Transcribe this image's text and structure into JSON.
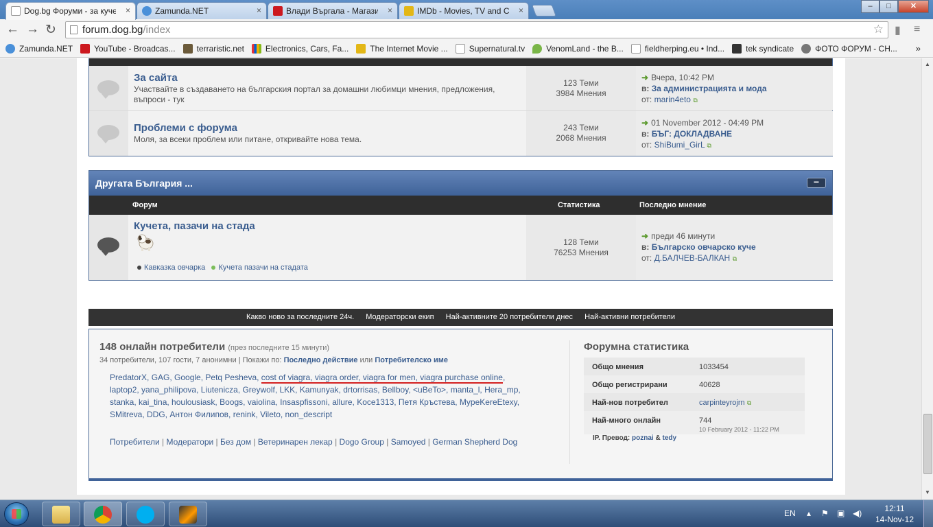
{
  "browser": {
    "tabs": [
      {
        "title": "Dog.bg Форуми - за кучет",
        "active": true,
        "icon_color": "#ffffff"
      },
      {
        "title": "Zamunda.NET",
        "active": false,
        "icon_color": "#4a90d9"
      },
      {
        "title": "Влади Въргала - Магазин",
        "active": false,
        "icon_color": "#cc181e"
      },
      {
        "title": "IMDb - Movies, TV and Cel",
        "active": false,
        "icon_color": "#e3b716"
      }
    ],
    "close_glyph": "×",
    "window_buttons": {
      "minimize": "–",
      "maximize": "□",
      "close": "✕"
    },
    "url_host": "forum.dog.bg",
    "url_path": "/index",
    "bookmarks": [
      {
        "label": "Zamunda.NET",
        "icon_color": "#4a90d9"
      },
      {
        "label": "YouTube - Broadcas...",
        "icon_color": "#cc181e"
      },
      {
        "label": "terraristic.net",
        "icon_color": "#6b5a3a"
      },
      {
        "label": "Electronics, Cars, Fa...",
        "icon_color": "#e53238"
      },
      {
        "label": "The Internet Movie ...",
        "icon_color": "#e3b716"
      },
      {
        "label": "Supernatural.tv",
        "icon_color": "#dddddd"
      },
      {
        "label": "VenomLand - the B...",
        "icon_color": "#7ab648"
      },
      {
        "label": "fieldherping.eu • Ind...",
        "icon_color": "#dddddd"
      },
      {
        "label": "tek syndicate",
        "icon_color": "#333333"
      },
      {
        "label": "ФОТО ФОРУМ - СН...",
        "icon_color": "#777777"
      }
    ],
    "bookmarks_more": "»"
  },
  "forum_top": {
    "rows": [
      {
        "title": "За сайта",
        "desc": "Участвайте в създаването на българския портал за домашни любимци мнения, предложения, въпроси - тук",
        "topics": "123 Теми",
        "posts": "3984 Мнения",
        "last_date": "Вчера, 10:42 PM",
        "last_in_prefix": "в:",
        "last_title": "За администрацията и мода",
        "last_by_prefix": "от:",
        "last_user": "marin4eto"
      },
      {
        "title": "Проблеми с форума",
        "desc": "Моля, за всеки проблем или питане, откривайте нова тема.",
        "topics": "243 Теми",
        "posts": "2068 Мнения",
        "last_date": "01 November 2012 - 04:49 PM",
        "last_in_prefix": "в:",
        "last_title": "БЪГ: ДОКЛАДВАНЕ",
        "last_by_prefix": "от:",
        "last_user": "ShiBumi_GirL"
      }
    ]
  },
  "category": {
    "title": "Другата България ...",
    "collapse_glyph": "−",
    "col_forum": "Форум",
    "col_stats": "Статистика",
    "col_last": "Последно мнение",
    "row": {
      "title": "Кучета, пазачи на стада",
      "topics": "128 Теми",
      "posts": "76253 Мнения",
      "last_date": "преди 46 минути",
      "last_in_prefix": "в:",
      "last_title": "Българско овчарско куче",
      "last_by_prefix": "от:",
      "last_user": "Д.БАЛЧЕВ-БАЛКАН",
      "subforums": [
        "Кавказка овчарка",
        "Кучета пазачи на стадата"
      ]
    }
  },
  "bottom_nav": [
    "Какво ново за последните 24ч.",
    "Модераторски екип",
    "Най-активните 20 потребители днес",
    "Най-активни потребители"
  ],
  "online": {
    "title": "148 онлайн потребители",
    "title_note": "(през последните 15 минути)",
    "summary": "34 потребители, 107 гости, 7 анонимни | Покажи по:",
    "sort_a": "Последно действие",
    "sort_or": "или",
    "sort_b": "Потребителско име",
    "users_line1_pre": "PredatorX, GAG, Google, Petq Pesheva,",
    "users_spam": "cost of viagra, viagra order, viagra for men, viagra purchase online",
    "users_rest": ", laptop2, yana_philipova, Liutenicza, Greywolf, LKK, Kamunyak, drtorrisas, Bellboy, <uBeTo>, manta_l, Hera_mp, stanka, kai_tina, houlousiask, Boogs, vaiolina, Insaspfissoni, allure, Koce1313, Петя Кръстева, MypeKereEtexy, SMitreva, DDG, Антон Филипов, renink, Vileto, non_descript",
    "groups": [
      "Потребители",
      "Модератори",
      "Без дом",
      "Ветеринарен лекар",
      "Dogo Group",
      "Samoyed",
      "German Shepherd Dog"
    ]
  },
  "stats": {
    "title": "Форумна статистика",
    "rows": [
      {
        "k": "Общо мнения",
        "v": "1033454"
      },
      {
        "k": "Общо регистрирани",
        "v": "40628"
      },
      {
        "k": "Най-нов потребител",
        "v": "carpinteyrojrn"
      },
      {
        "k": "Най-много онлайн",
        "v": "744",
        "v2": "10 February 2012 - 11:22 PM"
      }
    ],
    "credits_label": "IP. Превод:",
    "credits_a": "poznai",
    "credits_amp": "&",
    "credits_b": "tedy"
  },
  "taskbar": {
    "lang": "EN",
    "time": "12:11",
    "date": "14-Nov-12"
  }
}
